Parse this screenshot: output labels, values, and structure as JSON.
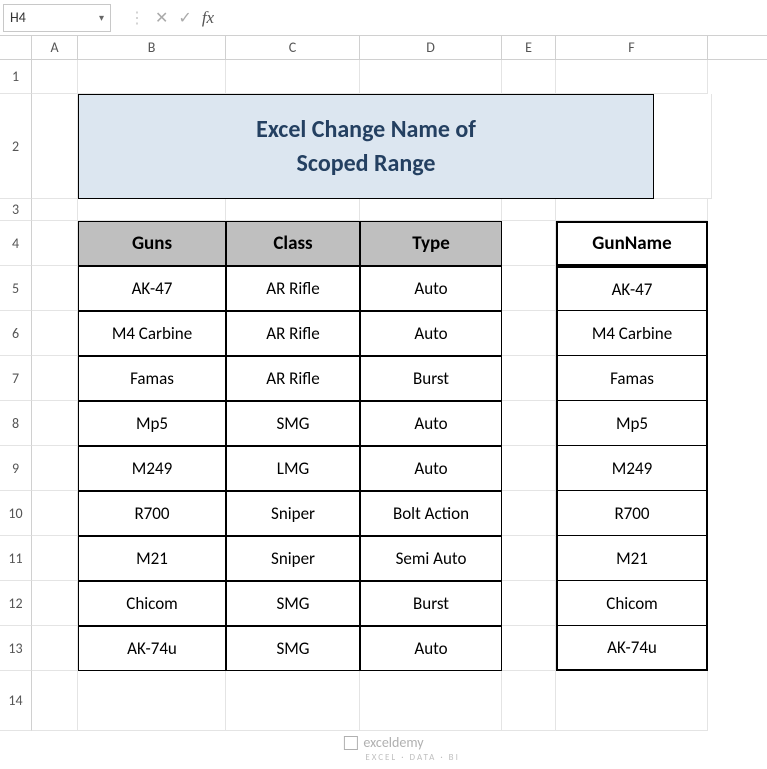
{
  "name_box": "H4",
  "formula": "",
  "columns": [
    "A",
    "B",
    "C",
    "D",
    "E",
    "F"
  ],
  "rows": [
    "1",
    "2",
    "3",
    "4",
    "5",
    "6",
    "7",
    "8",
    "9",
    "10",
    "11",
    "12",
    "13",
    "14"
  ],
  "title_line1": "Excel Change Name of",
  "title_line2": "Scoped Range",
  "table1": {
    "headers": [
      "Guns",
      "Class",
      "Type"
    ],
    "data": [
      [
        "AK-47",
        "AR Rifle",
        "Auto"
      ],
      [
        "M4 Carbine",
        "AR Rifle",
        "Auto"
      ],
      [
        "Famas",
        "AR Rifle",
        "Burst"
      ],
      [
        "Mp5",
        "SMG",
        "Auto"
      ],
      [
        "M249",
        "LMG",
        "Auto"
      ],
      [
        "R700",
        "Sniper",
        "Bolt Action"
      ],
      [
        "M21",
        "Sniper",
        "Semi Auto"
      ],
      [
        "Chicom",
        "SMG",
        "Burst"
      ],
      [
        "AK-74u",
        "SMG",
        "Auto"
      ]
    ]
  },
  "table2": {
    "header": "GunName",
    "data": [
      "AK-47",
      "M4 Carbine",
      "Famas",
      "Mp5",
      "M249",
      "R700",
      "M21",
      "Chicom",
      "AK-74u"
    ]
  },
  "watermark": "exceldemy",
  "watermark_sub": "EXCEL · DATA · BI",
  "chart_data": {
    "type": "table",
    "title": "Excel Change Name of Scoped Range",
    "columns": [
      "Guns",
      "Class",
      "Type",
      "GunName"
    ],
    "rows": [
      [
        "AK-47",
        "AR Rifle",
        "Auto",
        "AK-47"
      ],
      [
        "M4 Carbine",
        "AR Rifle",
        "Auto",
        "M4 Carbine"
      ],
      [
        "Famas",
        "AR Rifle",
        "Burst",
        "Famas"
      ],
      [
        "Mp5",
        "SMG",
        "Auto",
        "Mp5"
      ],
      [
        "M249",
        "LMG",
        "Auto",
        "M249"
      ],
      [
        "R700",
        "Sniper",
        "Bolt Action",
        "R700"
      ],
      [
        "M21",
        "Sniper",
        "Semi Auto",
        "M21"
      ],
      [
        "Chicom",
        "SMG",
        "Burst",
        "Chicom"
      ],
      [
        "AK-74u",
        "SMG",
        "Auto",
        "AK-74u"
      ]
    ]
  }
}
